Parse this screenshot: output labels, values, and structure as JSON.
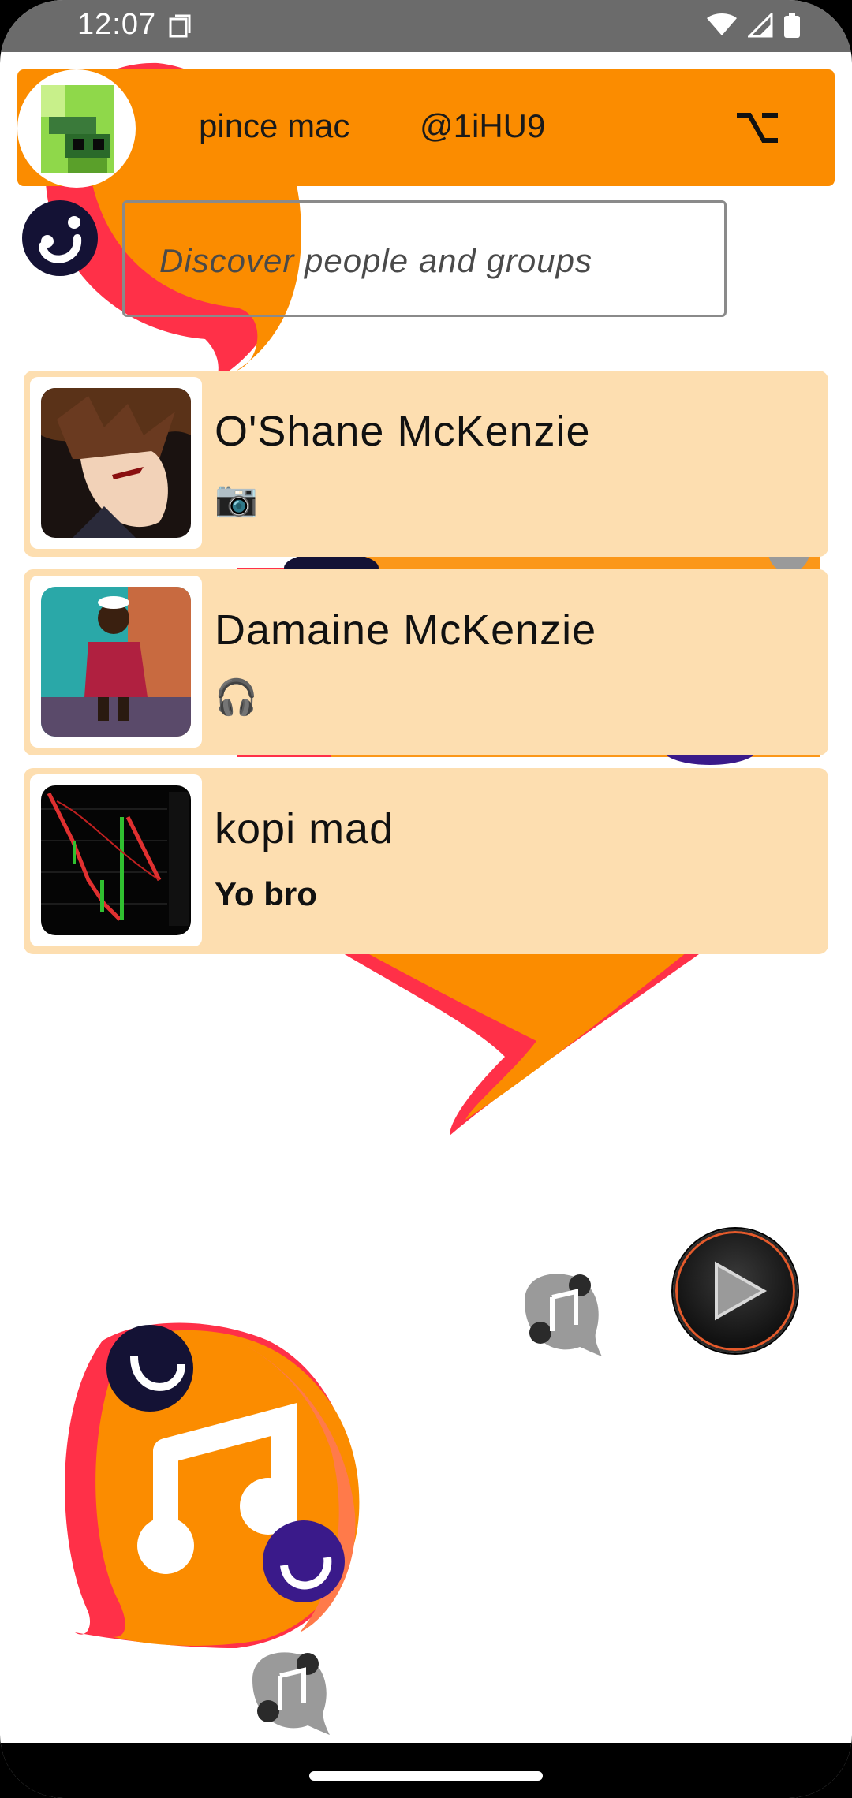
{
  "status_bar": {
    "time": "12:07",
    "icons": [
      "screenshot-icon",
      "wifi-icon",
      "signal-icon",
      "battery-icon"
    ]
  },
  "header": {
    "user_name": "pince mac",
    "user_handle": "@1iHU9",
    "menu_icon": "option-key-icon",
    "background_color": "#fb8c00"
  },
  "search": {
    "placeholder": "Discover people and groups"
  },
  "chats": [
    {
      "name": "O'Shane McKenzie",
      "preview": "📷",
      "preview_bold": false
    },
    {
      "name": "Damaine McKenzie",
      "preview": "🎧",
      "preview_bold": false
    },
    {
      "name": "kopi mad",
      "preview": "Yo bro",
      "preview_bold": true
    }
  ],
  "colors": {
    "accent": "#fb8c00",
    "chat_item_bg": "#fddeb0",
    "logo_red": "#ff3048",
    "logo_navy": "#141235",
    "logo_purple": "#3a1a8a"
  }
}
